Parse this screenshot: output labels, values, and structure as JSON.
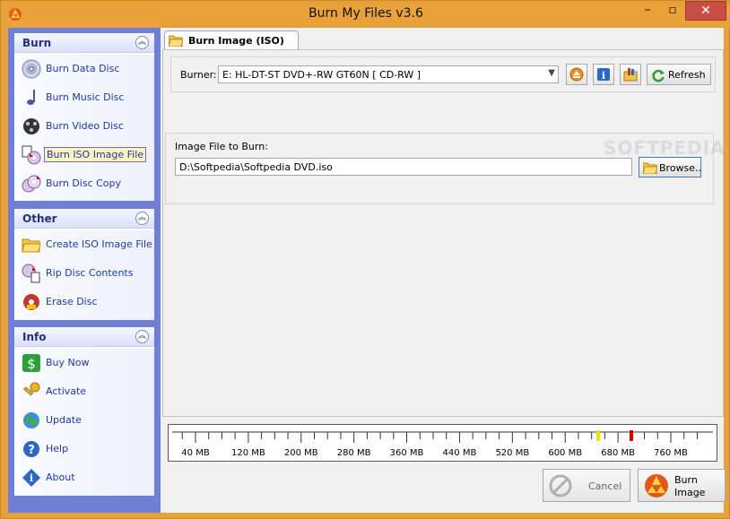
{
  "window": {
    "title": "Burn My Files v3.6"
  },
  "sidebar": {
    "groups": [
      {
        "title": "Burn",
        "items": [
          {
            "label": "Burn Data Disc",
            "icon": "disc-icon"
          },
          {
            "label": "Burn Music Disc",
            "icon": "music-note-icon"
          },
          {
            "label": "Burn Video Disc",
            "icon": "film-reel-icon"
          },
          {
            "label": "Burn ISO Image File",
            "icon": "iso-disc-icon"
          },
          {
            "label": "Burn Disc Copy",
            "icon": "disc-copy-icon"
          }
        ]
      },
      {
        "title": "Other",
        "items": [
          {
            "label": "Create ISO Image File",
            "icon": "folder-open-icon"
          },
          {
            "label": "Rip Disc Contents",
            "icon": "rip-disc-icon"
          },
          {
            "label": "Erase Disc",
            "icon": "erase-disc-icon"
          }
        ]
      },
      {
        "title": "Info",
        "items": [
          {
            "label": "Buy Now",
            "icon": "dollar-icon"
          },
          {
            "label": "Activate",
            "icon": "key-icon"
          },
          {
            "label": "Update",
            "icon": "globe-update-icon"
          },
          {
            "label": "Help",
            "icon": "help-icon"
          },
          {
            "label": "About",
            "icon": "info-diamond-icon"
          }
        ]
      }
    ]
  },
  "tab": {
    "label": "Burn Image (ISO)"
  },
  "burner": {
    "label": "Burner:",
    "value": "E: HL-DT-ST DVD+-RW GT60N [ CD-RW ]",
    "refresh_label": "Refresh"
  },
  "image_file": {
    "label": "Image File to Burn:",
    "value": "D:\\Softpedia\\Softpedia DVD.iso",
    "browse_label": "Browse.."
  },
  "watermark": "SOFTPEDIA",
  "ruler": {
    "labels": [
      "40 MB",
      "120 MB",
      "200 MB",
      "280 MB",
      "360 MB",
      "440 MB",
      "520 MB",
      "600 MB",
      "680 MB",
      "760 MB"
    ],
    "yellow_marker_mb": 650,
    "red_marker_mb": 700,
    "colors": {
      "yellow": "#f2e200",
      "red": "#d40000"
    }
  },
  "actions": {
    "cancel_label": "Cancel",
    "burn_label_line1": "Burn",
    "burn_label_line2": "Image"
  },
  "colors": {
    "accent_title": "#eaa13a",
    "sidebar_bg": "#6f7fd6",
    "link_text": "#1d3aa0"
  }
}
